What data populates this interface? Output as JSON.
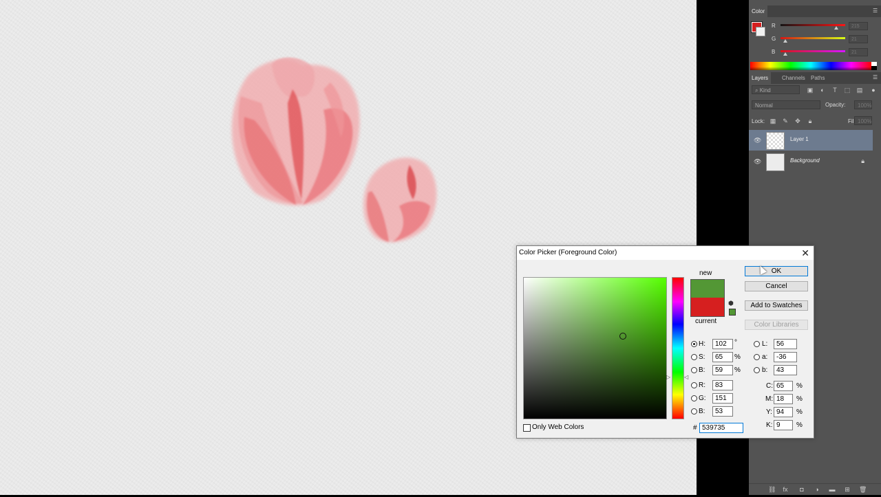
{
  "color_panel": {
    "tab": "Color",
    "foreground_color": "#d61f1f",
    "background_color": "#f1f1f1",
    "sliders": [
      {
        "label": "R",
        "value": "215",
        "level": 0.84
      },
      {
        "label": "G",
        "value": "21",
        "level": 0.08
      },
      {
        "label": "B",
        "value": "21",
        "level": 0.08
      }
    ]
  },
  "layers_panel": {
    "tabs": [
      "Layers",
      "Channels",
      "Paths"
    ],
    "filter_kind": "Kind",
    "blend_mode": "Normal",
    "opacity_label": "Opacity:",
    "opacity_value": "100%",
    "lock_label": "Lock:",
    "fill_label": "Fill:",
    "fill_value": "100%",
    "layers": [
      {
        "name": "Layer 1",
        "selected": true,
        "locked": false
      },
      {
        "name": "Background",
        "selected": false,
        "locked": true
      }
    ]
  },
  "dialog": {
    "title": "Color Picker (Foreground Color)",
    "buttons": {
      "ok": "OK",
      "cancel": "Cancel",
      "add_to_swatches": "Add to Swatches",
      "color_libraries": "Color Libraries"
    },
    "new_label": "new",
    "current_label": "current",
    "new_color": "#539735",
    "current_color": "#d61f1f",
    "hsb": [
      {
        "label": "H:",
        "value": "102",
        "unit": "°",
        "selected": true
      },
      {
        "label": "S:",
        "value": "65",
        "unit": "%",
        "selected": false
      },
      {
        "label": "B:",
        "value": "59",
        "unit": "%",
        "selected": false
      }
    ],
    "rgb": [
      {
        "label": "R:",
        "value": "83"
      },
      {
        "label": "G:",
        "value": "151"
      },
      {
        "label": "B:",
        "value": "53"
      }
    ],
    "lab": [
      {
        "label": "L:",
        "value": "56"
      },
      {
        "label": "a:",
        "value": "-36"
      },
      {
        "label": "b:",
        "value": "43"
      }
    ],
    "cmyk": [
      {
        "label": "C:",
        "value": "65",
        "unit": "%"
      },
      {
        "label": "M:",
        "value": "18",
        "unit": "%"
      },
      {
        "label": "Y:",
        "value": "94",
        "unit": "%"
      },
      {
        "label": "K:",
        "value": "9",
        "unit": "%"
      }
    ],
    "only_web_colors_label": "Only Web Colors",
    "hash_label": "#",
    "hex_value": "539735"
  }
}
